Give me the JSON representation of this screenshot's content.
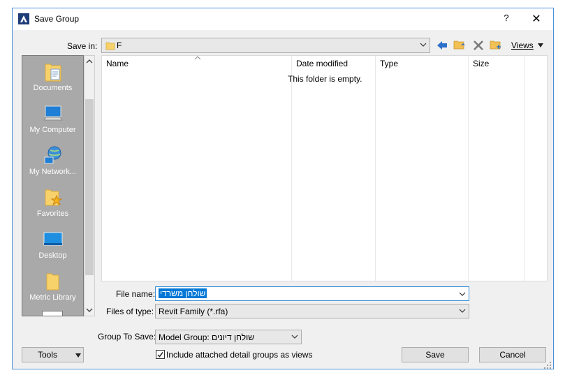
{
  "window": {
    "title": "Save Group",
    "help": "?",
    "close": "✕"
  },
  "save_in": {
    "label": "Save in:",
    "value": "F"
  },
  "toolbar": {
    "views_label": "Views"
  },
  "places": [
    {
      "label": "Documents",
      "icon": "documents-icon"
    },
    {
      "label": "My Computer",
      "icon": "computer-icon"
    },
    {
      "label": "My Network...",
      "icon": "network-icon"
    },
    {
      "label": "Favorites",
      "icon": "favorites-icon"
    },
    {
      "label": "Desktop",
      "icon": "desktop-icon"
    },
    {
      "label": "Metric Library",
      "icon": "folder-icon"
    }
  ],
  "list": {
    "columns": [
      "Name",
      "Date modified",
      "Type",
      "Size"
    ],
    "empty_message": "This folder is empty."
  },
  "file_name": {
    "label": "File name:",
    "value": "שולחן משרדי"
  },
  "file_type": {
    "label": "Files of type:",
    "value": "Revit Family  (*.rfa)"
  },
  "group_to_save": {
    "label": "Group To Save:",
    "value": "Model Group: שולחן דיונים"
  },
  "include_attached": {
    "label": "Include attached detail groups as views",
    "checked": true
  },
  "buttons": {
    "tools": "Tools",
    "save": "Save",
    "cancel": "Cancel"
  },
  "colors": {
    "accent": "#0078d7",
    "places_bg": "#a9a9a9",
    "window_border": "#4a90d9"
  }
}
